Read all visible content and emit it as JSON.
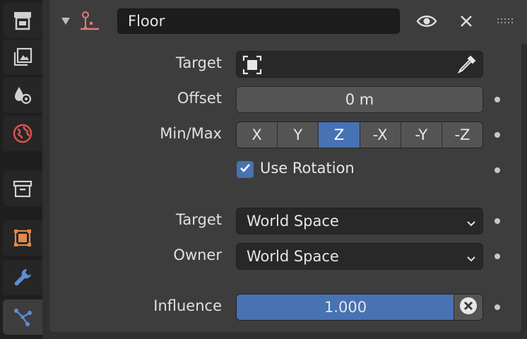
{
  "sidebar": {
    "tabs": [
      {
        "icon": "output-properties-icon"
      },
      {
        "icon": "view-layer-icon"
      },
      {
        "icon": "scene-icon"
      },
      {
        "icon": "world-icon"
      },
      {
        "icon": "collection-icon"
      },
      {
        "icon": "object-icon"
      },
      {
        "icon": "modifier-wrench-icon"
      },
      {
        "icon": "particles-icon"
      }
    ]
  },
  "constraint": {
    "name": "Floor",
    "target_label": "Target",
    "offset_label": "Offset",
    "offset_value": "0 m",
    "minmax_label": "Min/Max",
    "axes": [
      "X",
      "Y",
      "Z",
      "-X",
      "-Y",
      "-Z"
    ],
    "active_axis": "Z",
    "use_rotation_label": "Use Rotation",
    "use_rotation_checked": true,
    "target_space_label": "Target",
    "target_space_value": "World Space",
    "owner_space_label": "Owner",
    "owner_space_value": "World Space",
    "influence_label": "Influence",
    "influence_value": "1.000",
    "influence_fraction": 1.0
  },
  "colors": {
    "accent": "#4772b3",
    "constraint_icon": "#e07a7a"
  }
}
